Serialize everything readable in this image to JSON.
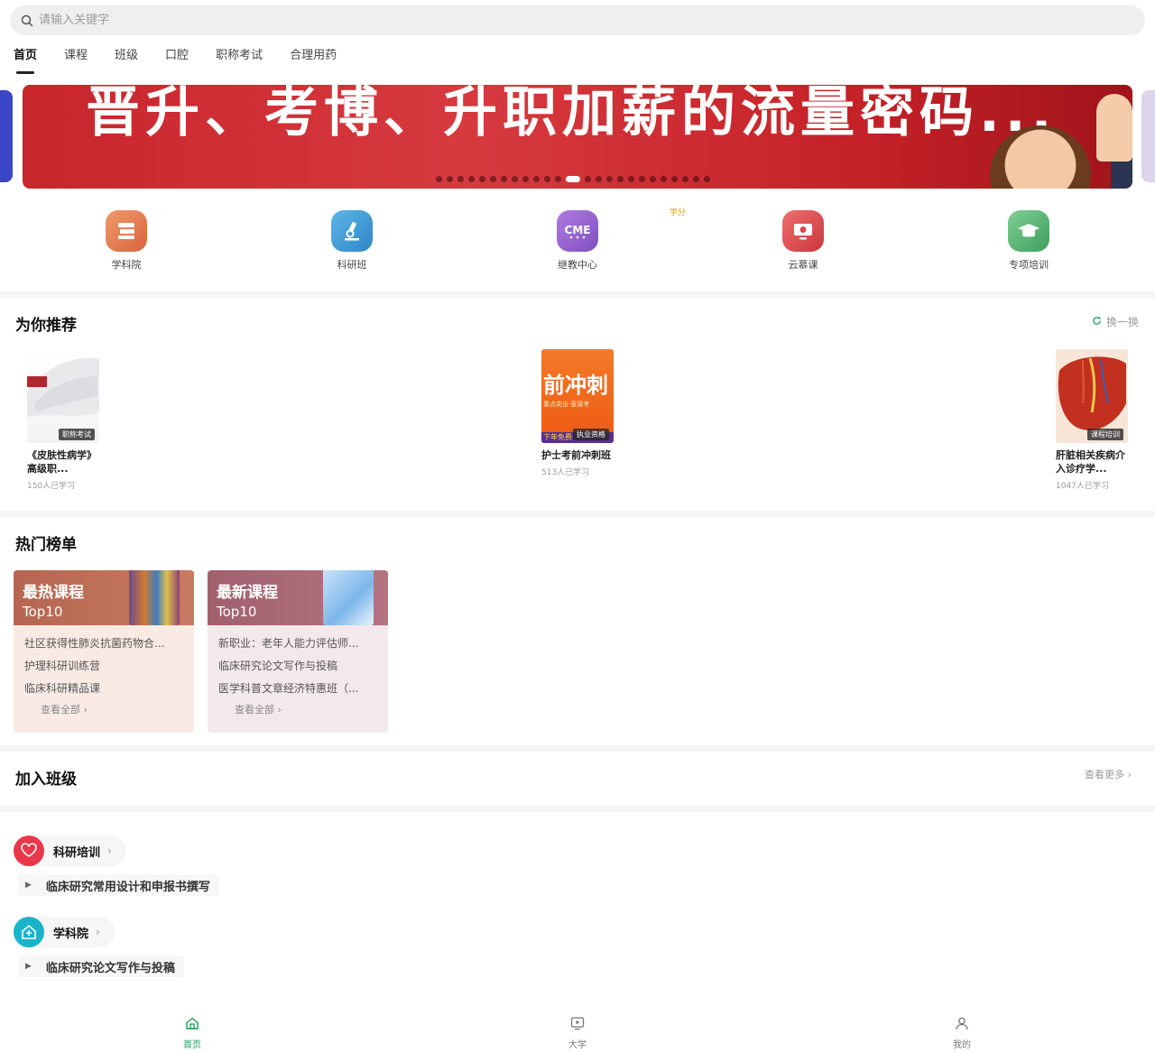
{
  "search": {
    "placeholder": "请输入关键字"
  },
  "tabs": [
    {
      "label": "首页"
    },
    {
      "label": "课程"
    },
    {
      "label": "班级"
    },
    {
      "label": "口腔"
    },
    {
      "label": "职称考试"
    },
    {
      "label": "合理用药"
    }
  ],
  "banner": {
    "headline": "晋升、考博、升职加薪的流量密码...",
    "slide_count": 25,
    "active_slide": 12
  },
  "quick": {
    "items": [
      {
        "label": "学科院",
        "icon": "book-stack-icon"
      },
      {
        "label": "科研班",
        "icon": "microscope-icon"
      },
      {
        "label": "继教中心",
        "icon": "cme-icon"
      },
      {
        "label": "云慕课",
        "icon": "cloud-monitor-icon"
      },
      {
        "label": "专项培训",
        "icon": "graduation-cap-icon"
      }
    ],
    "badge": "学分"
  },
  "recommend": {
    "title": "为你推荐",
    "refresh": "换一换",
    "cards": [
      {
        "title": "《皮肤性病学》高级职...",
        "learners": "150人已学习",
        "tag": "职称考试"
      },
      {
        "title": "护士考前冲刺班",
        "learners": "513人已学习",
        "tag": "执业资格",
        "cover_text": "前冲刺",
        "cover_sub": "重点突击·直接考",
        "cover_foot": "下年免费"
      },
      {
        "title": "肝脏相关疾病介入诊疗学...",
        "learners": "1047人已学习",
        "tag": "课程培训"
      }
    ]
  },
  "hot": {
    "title": "热门榜单",
    "lists": [
      {
        "h1": "最热课程",
        "h2": "Top10",
        "items": [
          "社区获得性肺炎抗菌药物合...",
          "护理科研训练营",
          "临床科研精品课"
        ],
        "all": "查看全部"
      },
      {
        "h1": "最新课程",
        "h2": "Top10",
        "items": [
          "新职业：老年人能力评估师...",
          "临床研究论文写作与投稿",
          "医学科普文章经济特惠班（..."
        ],
        "all": "查看全部"
      }
    ]
  },
  "classes": {
    "title": "加入班级",
    "more": "查看更多",
    "groups": [
      {
        "label": "科研培训",
        "lesson": "临床研究常用设计和申报书撰写",
        "color": "#e8384a"
      },
      {
        "label": "学科院",
        "lesson": "临床研究论文写作与投稿",
        "color": "#19b4c9"
      }
    ]
  },
  "nav": [
    {
      "label": "首页",
      "icon": "home-icon",
      "active": true
    },
    {
      "label": "大学",
      "icon": "video-screen-icon",
      "active": false
    },
    {
      "label": "我的",
      "icon": "user-icon",
      "active": false
    }
  ]
}
